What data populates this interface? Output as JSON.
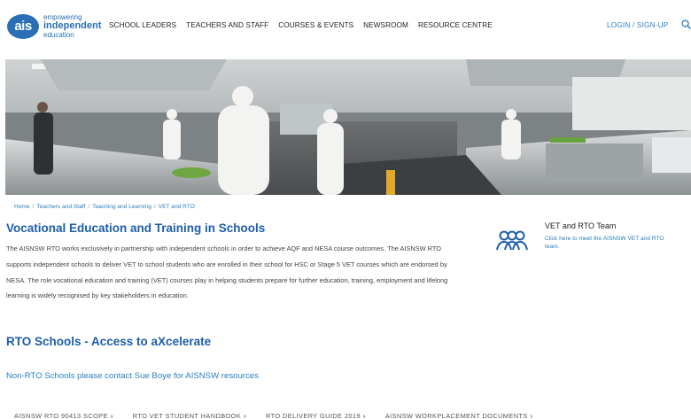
{
  "header": {
    "logo": {
      "mark": "ais",
      "line1": "empowering",
      "line2": "independent",
      "line3": "education"
    },
    "nav": [
      "SCHOOL LEADERS",
      "TEACHERS AND STAFF",
      "COURSES & EVENTS",
      "NEWSROOM",
      "RESOURCE CENTRE"
    ],
    "login": "LOGIN / SIGN-UP"
  },
  "breadcrumb": [
    "Home",
    "Teachers and Staff",
    "Teaching and Learning",
    "VET and RTO"
  ],
  "main": {
    "title": "Vocational Education and Training in Schools",
    "intro": "The AISNSW RTO works exclusively in partnership with independent schools in order to achieve AQF and NESA course outcomes. The AISNSW RTO supports independent schools to deliver VET to school students who are enrolled in their school for HSC or Stage 5 VET courses which are endorsed by NESA. The role vocational education and training (VET) courses play in helping students prepare for further education, training, employment and lifelong learning is widely recognised by key stakeholders in education.",
    "section_title": "RTO Schools - Access to aXcelerate",
    "contact": "Non-RTO Schools please contact Sue Boye for AISNSW resources"
  },
  "sidebar": {
    "team_title": "VET and RTO Team",
    "team_link": "Click here to meet the AISNSW VET and RTO team."
  },
  "documents": [
    "AISNSW RTO 90413 SCOPE",
    "RTO VET STUDENT HANDBOOK",
    "RTO DELIVERY GUIDE 2019",
    "AISNSW WORKPLACEMENT DOCUMENTS"
  ],
  "colors": {
    "brand_blue": "#1d5ea8",
    "link_blue": "#2a7fc1"
  },
  "icons": {
    "search": "search-icon",
    "team": "team-icon",
    "chevron": "chevron-right-icon"
  }
}
